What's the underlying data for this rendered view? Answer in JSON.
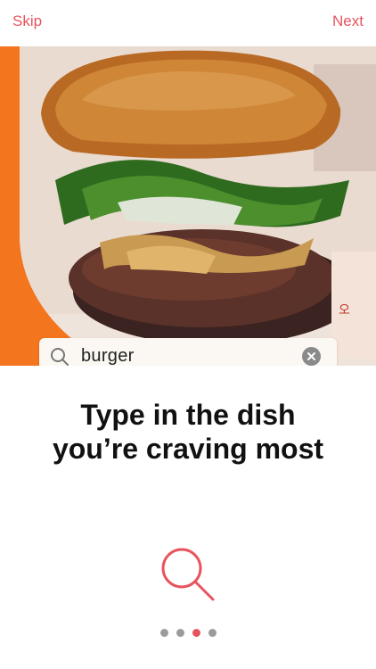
{
  "nav": {
    "skip_label": "Skip",
    "next_label": "Next"
  },
  "search": {
    "value": "burger",
    "icon": "search-icon",
    "clear_icon": "clear-icon"
  },
  "headline": {
    "line1": "Type in the dish",
    "line2": "you’re craving most"
  },
  "feature_icon": "search-icon",
  "pagination": {
    "total": 4,
    "active_index": 2
  },
  "colors": {
    "accent": "#e8545e",
    "hero_background": "#f3751e",
    "dot_inactive": "#9b9b9b",
    "headline_text": "#111111"
  }
}
